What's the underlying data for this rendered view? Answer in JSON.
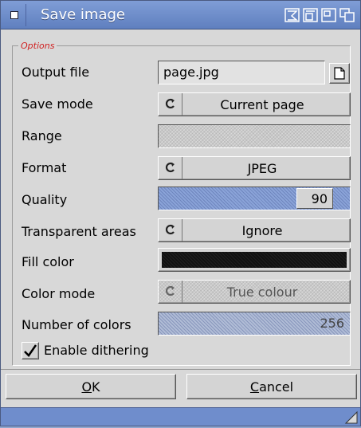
{
  "window": {
    "title": "Save image"
  },
  "options": {
    "group_title": "Options",
    "output_file": {
      "label": "Output file",
      "value": "page.jpg"
    },
    "save_mode": {
      "label": "Save mode",
      "value": "Current page"
    },
    "range": {
      "label": "Range",
      "value": ""
    },
    "format": {
      "label": "Format",
      "value": "JPEG"
    },
    "quality": {
      "label": "Quality",
      "value": "90"
    },
    "transparent_areas": {
      "label": "Transparent areas",
      "value": "Ignore"
    },
    "fill_color": {
      "label": "Fill color",
      "value": "#000000"
    },
    "color_mode": {
      "label": "Color mode",
      "value": "True colour"
    },
    "number_of_colors": {
      "label": "Number of colors",
      "value": "256"
    },
    "enable_dithering": {
      "label": "Enable dithering",
      "checked": true
    }
  },
  "buttons": {
    "ok_underline": "O",
    "ok_rest": "K",
    "cancel_underline": "C",
    "cancel_rest": "ancel"
  },
  "icons": {
    "close": "close-gadget-icon",
    "iconify": "iconify-icon",
    "zoom": "zoom-icon",
    "depth": "depth-icon",
    "popup": "popup-icon",
    "cycle": "cycle-icon",
    "getfile": "getfile-icon",
    "resize": "resize-icon"
  },
  "colors": {
    "titlebar": "#6f8dcc",
    "window_bg": "#d8d8d8",
    "group_title": "#d02020",
    "slider_fill": "#8aa3d8"
  }
}
